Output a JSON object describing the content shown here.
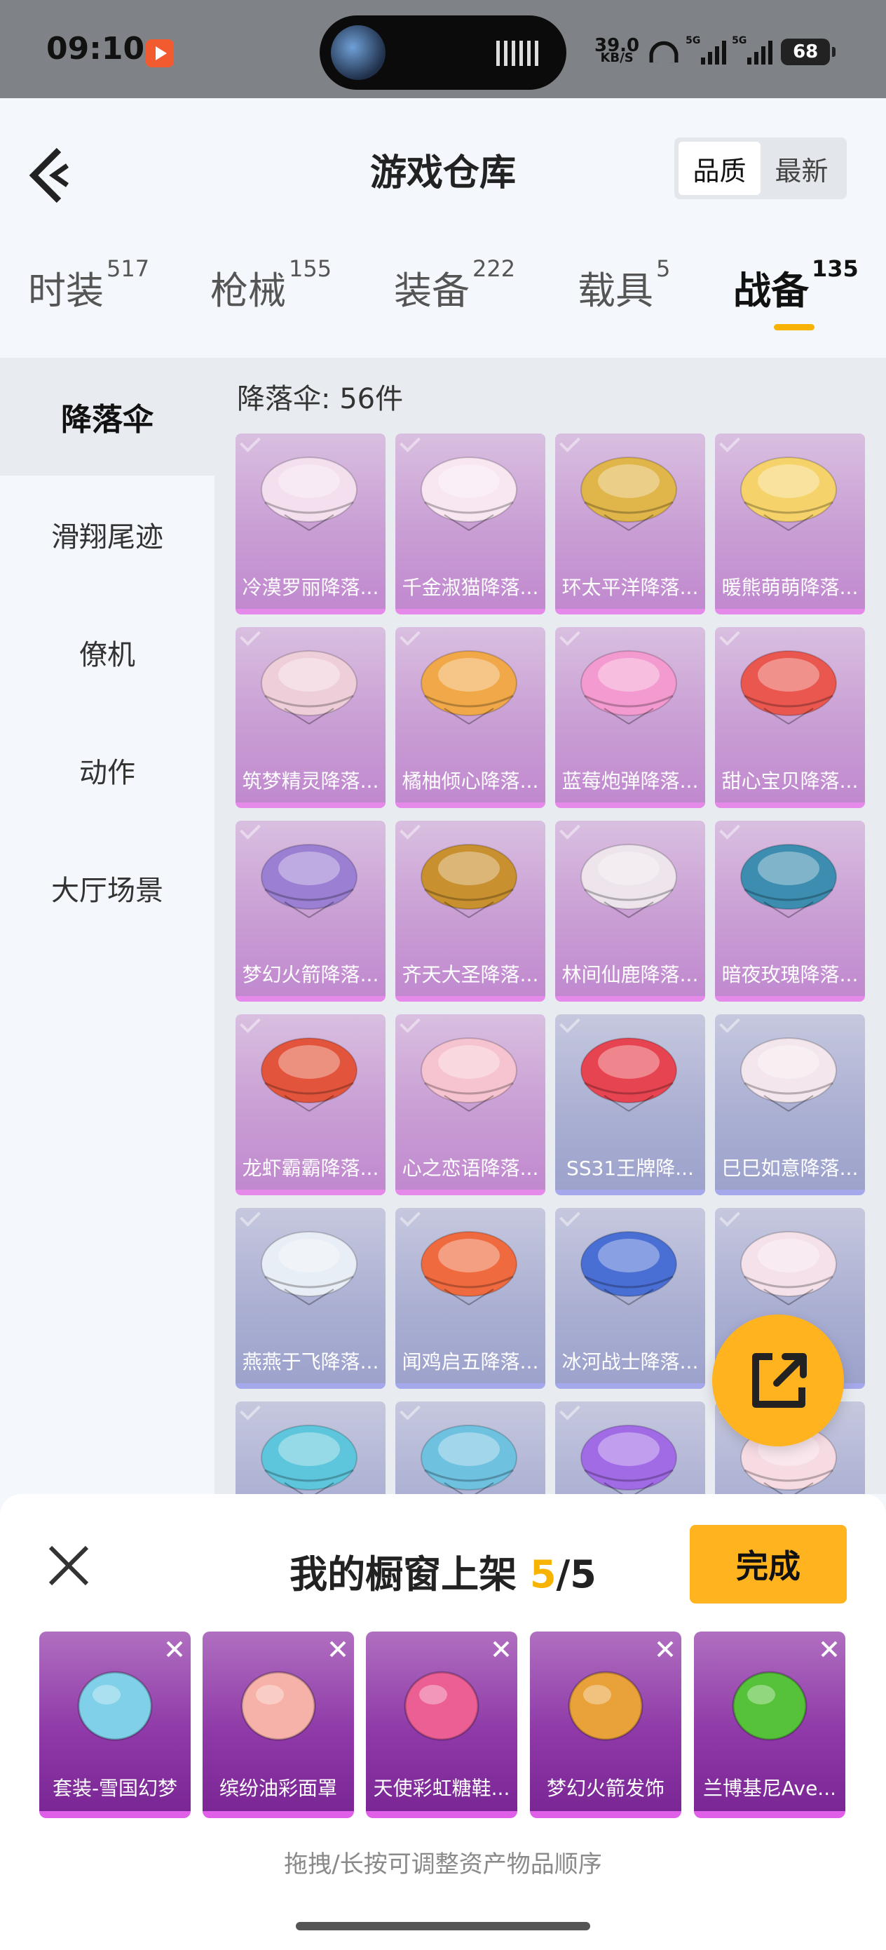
{
  "status_bar": {
    "time": "09:10",
    "net_speed_value": "39.0",
    "net_speed_unit": "KB/S",
    "signal1_label": "5G",
    "signal2_label": "5G",
    "battery": "68"
  },
  "header": {
    "title": "游戏仓库",
    "sort_options": [
      "品质",
      "最新"
    ],
    "active_sort": "品质"
  },
  "categories": [
    {
      "label": "时装",
      "count": "517"
    },
    {
      "label": "枪械",
      "count": "155"
    },
    {
      "label": "装备",
      "count": "222"
    },
    {
      "label": "载具",
      "count": "5"
    },
    {
      "label": "战备",
      "count": "135",
      "active": true
    }
  ],
  "sidebar": {
    "items": [
      "降落伞",
      "滑翔尾迹",
      "僚机",
      "动作",
      "大厅场景"
    ],
    "active": "降落伞"
  },
  "grid": {
    "count_label": "降落伞: 56件",
    "items": [
      {
        "name": "冷漠罗丽降落...",
        "tier": "purple",
        "color": "#f3dfee"
      },
      {
        "name": "千金淑猫降落...",
        "tier": "purple",
        "color": "#f8e6f1"
      },
      {
        "name": "环太平洋降落...",
        "tier": "purple",
        "color": "#e0b54a"
      },
      {
        "name": "暖熊萌萌降落...",
        "tier": "purple",
        "color": "#f5d36a"
      },
      {
        "name": "筑梦精灵降落...",
        "tier": "purple",
        "color": "#eecfd9"
      },
      {
        "name": "橘柚倾心降落...",
        "tier": "purple",
        "color": "#f0a848"
      },
      {
        "name": "蓝莓炮弹降落...",
        "tier": "purple",
        "color": "#f39bd0"
      },
      {
        "name": "甜心宝贝降落...",
        "tier": "purple",
        "color": "#e9574f"
      },
      {
        "name": "梦幻火箭降落...",
        "tier": "purple",
        "color": "#9a7fd3"
      },
      {
        "name": "齐天大圣降落...",
        "tier": "purple",
        "color": "#c8902f"
      },
      {
        "name": "林间仙鹿降落...",
        "tier": "purple",
        "color": "#ede4ec"
      },
      {
        "name": "暗夜玫瑰降落...",
        "tier": "purple",
        "color": "#3c8db0"
      },
      {
        "name": "龙虾霸霸降落...",
        "tier": "purple",
        "color": "#e2553c"
      },
      {
        "name": "心之恋语降落...",
        "tier": "purple",
        "color": "#f6c3d0"
      },
      {
        "name": "SS31王牌降...",
        "tier": "blue",
        "color": "#e64450"
      },
      {
        "name": "巳巳如意降落...",
        "tier": "blue",
        "color": "#f3e6ec"
      },
      {
        "name": "燕燕于飞降落...",
        "tier": "blue",
        "color": "#e8eef5"
      },
      {
        "name": "闻鸡启五降落...",
        "tier": "blue",
        "color": "#ef6a3f"
      },
      {
        "name": "冰河战士降落...",
        "tier": "blue",
        "color": "#4a6fd4"
      },
      {
        "name": "",
        "tier": "blue",
        "color": "#f4e1ea"
      },
      {
        "name": "",
        "tier": "blue",
        "color": "#5ec6dc"
      },
      {
        "name": "",
        "tier": "blue",
        "color": "#6fc1e0"
      },
      {
        "name": "",
        "tier": "blue",
        "color": "#a16be6"
      },
      {
        "name": "",
        "tier": "blue",
        "color": "#f6dbe3"
      }
    ]
  },
  "fab": {
    "icon": "share-icon"
  },
  "showcase": {
    "title_prefix": "我的橱窗上架 ",
    "current": "5",
    "total": "/5",
    "done_label": "完成",
    "hint": "拖拽/长按可调整资产物品顺序",
    "slots": [
      {
        "name": "套装-雪国幻梦",
        "color": "#7fd0e8"
      },
      {
        "name": "缤纷油彩面罩",
        "color": "#f6b2a8"
      },
      {
        "name": "天使彩虹糖鞋...",
        "color": "#ec5f95"
      },
      {
        "name": "梦幻火箭发饰",
        "color": "#e9a13a"
      },
      {
        "name": "兰博基尼Ave...",
        "color": "#55c23a"
      }
    ]
  }
}
